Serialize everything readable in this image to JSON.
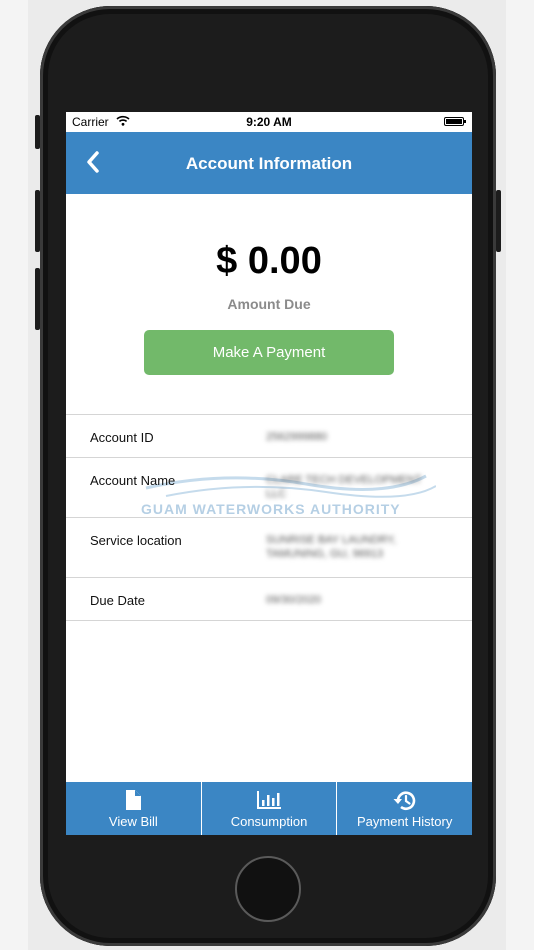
{
  "status": {
    "carrier": "Carrier",
    "time": "9:20 AM"
  },
  "header": {
    "title": "Account Information",
    "back_icon": "chevron-left-icon"
  },
  "summary": {
    "amount": "$ 0.00",
    "amount_label": "Amount Due",
    "pay_button": "Make A Payment"
  },
  "details": [
    {
      "label": "Account ID",
      "value": "2562999880"
    },
    {
      "label": "Account Name",
      "value": "CLARE TECH DEVELOPMENT LLC"
    },
    {
      "label": "Service location",
      "value": "SUNRISE BAY LAUNDRY, TAMUNING, GU, 96913"
    },
    {
      "label": "Due Date",
      "value": "09/30/2020"
    }
  ],
  "watermark": "GUAM WATERWORKS AUTHORITY",
  "tabs": [
    {
      "label": "View Bill",
      "icon": "document-icon"
    },
    {
      "label": "Consumption",
      "icon": "bar-chart-icon"
    },
    {
      "label": "Payment History",
      "icon": "history-icon"
    }
  ],
  "colors": {
    "primary": "#3b86c4",
    "pay_button": "#72b96a",
    "muted_text": "#8b8b8b"
  }
}
